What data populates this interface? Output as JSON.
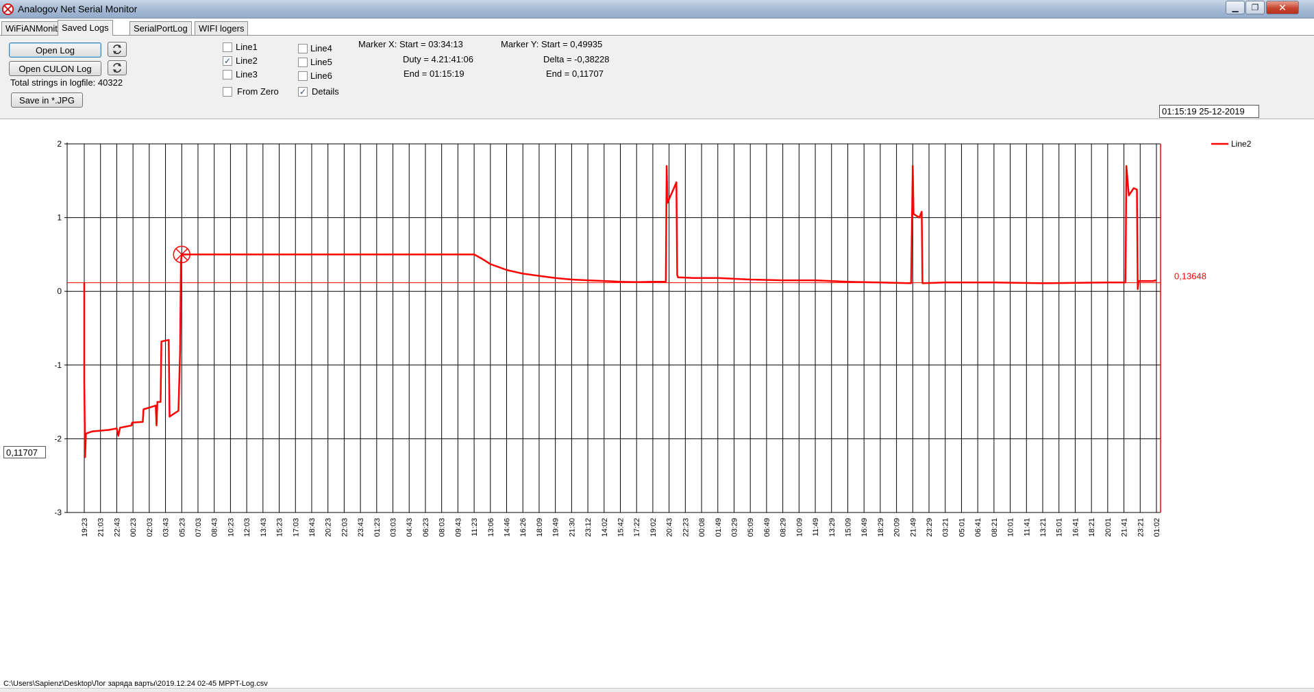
{
  "window": {
    "title": "Analogov Net Serial Monitor",
    "minimize": "▁",
    "maximize": "❐",
    "close": "✕"
  },
  "tabs": [
    "WiFiANMonitor",
    "Saved Logs",
    "SerialPortLog",
    "WIFI logers"
  ],
  "active_tab": "Saved Logs",
  "panel": {
    "open_log": "Open Log",
    "open_culon_log": "Open CULON Log",
    "refresh_icon": "refresh-icon",
    "total_strings": "Total strings in logfile: 40322",
    "save_jpg": "Save in *.JPG",
    "checkboxes": [
      {
        "label": "Line1",
        "checked": false
      },
      {
        "label": "Line2",
        "checked": true
      },
      {
        "label": "Line3",
        "checked": false
      },
      {
        "label": "From Zero",
        "checked": false
      },
      {
        "label": "Line4",
        "checked": false
      },
      {
        "label": "Line5",
        "checked": false
      },
      {
        "label": "Line6",
        "checked": false
      },
      {
        "label": "Details",
        "checked": true
      }
    ],
    "marker_x": {
      "start": "Marker X: Start = 03:34:13",
      "duty": "Duty = 4.21:41:06",
      "end": "End  = 01:15:19"
    },
    "marker_y": {
      "start": "Marker Y: Start = 0,49935",
      "delta": "Delta = -0,38228",
      "end": "End  = 0,11707"
    },
    "datetime": "01:15:19 25-12-2019"
  },
  "chart_data": {
    "type": "line",
    "ylim": [
      -3,
      2
    ],
    "yticks": [
      "2",
      "1",
      "0",
      "-1",
      "-2",
      "-3"
    ],
    "categories": [
      "19:23",
      "21:03",
      "22:43",
      "00:23",
      "02:03",
      "03:43",
      "05:23",
      "07:03",
      "08:43",
      "10:23",
      "12:03",
      "13:43",
      "15:23",
      "17:03",
      "18:43",
      "20:23",
      "22:03",
      "23:43",
      "01:23",
      "03:03",
      "04:43",
      "06:23",
      "08:03",
      "09:43",
      "11:23",
      "13:06",
      "14:46",
      "16:26",
      "18:09",
      "19:49",
      "21:30",
      "23:12",
      "14:02",
      "15:42",
      "17:22",
      "19:02",
      "20:43",
      "22:23",
      "00:08",
      "01:49",
      "03:29",
      "05:09",
      "06:49",
      "08:29",
      "10:09",
      "11:49",
      "13:29",
      "15:09",
      "16:49",
      "18:29",
      "20:09",
      "21:49",
      "23:29",
      "03:21",
      "05:01",
      "06:41",
      "08:21",
      "10:01",
      "11:41",
      "13:21",
      "15:01",
      "16:41",
      "18:21",
      "20:01",
      "21:41",
      "23:21",
      "01:02"
    ],
    "series": [
      {
        "name": "Line2",
        "color": "#ff0000",
        "points": [
          [
            0.0,
            0.12
          ],
          [
            0.0,
            -1.2
          ],
          [
            0.05,
            -2.25
          ],
          [
            0.1,
            -1.93
          ],
          [
            0.5,
            -1.9
          ],
          [
            1.5,
            -1.88
          ],
          [
            2.0,
            -1.86
          ],
          [
            2.1,
            -1.96
          ],
          [
            2.2,
            -1.85
          ],
          [
            2.9,
            -1.82
          ],
          [
            2.95,
            -1.78
          ],
          [
            3.6,
            -1.77
          ],
          [
            3.65,
            -1.6
          ],
          [
            4.4,
            -1.55
          ],
          [
            4.45,
            -1.82
          ],
          [
            4.5,
            -1.5
          ],
          [
            4.7,
            -1.5
          ],
          [
            4.75,
            -0.68
          ],
          [
            5.2,
            -0.66
          ],
          [
            5.25,
            -1.7
          ],
          [
            5.8,
            -1.62
          ],
          [
            5.9,
            -0.8
          ],
          [
            5.95,
            0.4
          ],
          [
            6.0,
            0.5
          ],
          [
            24.0,
            0.5
          ],
          [
            24.5,
            0.44
          ],
          [
            25.0,
            0.37
          ],
          [
            26.0,
            0.29
          ],
          [
            27.0,
            0.24
          ],
          [
            28.0,
            0.21
          ],
          [
            29.0,
            0.18
          ],
          [
            30.0,
            0.16
          ],
          [
            31.0,
            0.15
          ],
          [
            32.0,
            0.14
          ],
          [
            33.0,
            0.13
          ],
          [
            34.0,
            0.125
          ],
          [
            35.0,
            0.13
          ],
          [
            35.8,
            0.13
          ],
          [
            35.85,
            1.7
          ],
          [
            35.9,
            1.2
          ],
          [
            36.1,
            1.3
          ],
          [
            36.3,
            1.4
          ],
          [
            36.45,
            1.48
          ],
          [
            36.5,
            0.22
          ],
          [
            36.55,
            0.19
          ],
          [
            37.5,
            0.18
          ],
          [
            39.0,
            0.18
          ],
          [
            41.0,
            0.16
          ],
          [
            43.0,
            0.15
          ],
          [
            45.0,
            0.15
          ],
          [
            47.0,
            0.13
          ],
          [
            49.0,
            0.12
          ],
          [
            50.9,
            0.11
          ],
          [
            51.0,
            1.7
          ],
          [
            51.05,
            1.05
          ],
          [
            51.4,
            1.0
          ],
          [
            51.55,
            1.08
          ],
          [
            51.6,
            0.11
          ],
          [
            53.0,
            0.12
          ],
          [
            56.0,
            0.12
          ],
          [
            59.0,
            0.11
          ],
          [
            63.0,
            0.12
          ],
          [
            64.1,
            0.12
          ],
          [
            64.15,
            1.7
          ],
          [
            64.3,
            1.3
          ],
          [
            64.6,
            1.4
          ],
          [
            64.8,
            1.38
          ],
          [
            64.85,
            0.03
          ],
          [
            64.9,
            0.14
          ],
          [
            65.8,
            0.14
          ],
          [
            66.0,
            0.15
          ]
        ]
      }
    ],
    "marker_label": "0,13648",
    "y_marker_box": "0,11707",
    "legend": "top-right",
    "grid": true
  },
  "status": {
    "filepath": "C:\\Users\\Sapienz\\Desktop\\Лог заряда варты\\2019.12.24 02-45 MPPT-Log.csv"
  }
}
